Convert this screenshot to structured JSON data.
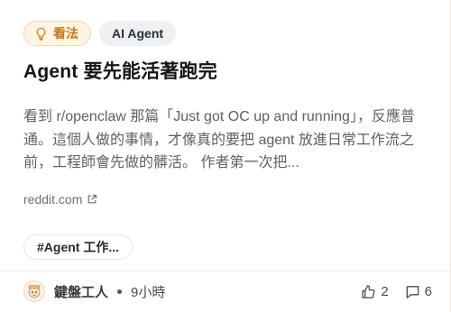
{
  "card": {
    "category_chip": "看法",
    "tag_chip": "AI Agent",
    "title": "Agent 要先能活著跑完",
    "excerpt": "看到 r/openclaw 那篇「Just got OC up and running」，反應普通。這個人做的事情，才像真的要把 agent 放進日常工作流之前，工程師會先做的髒活。 作者第一次把...",
    "source": "reddit.com",
    "hashtag": "#Agent 工作...",
    "author": "鍵盤工人",
    "time": "9小時",
    "likes": "2",
    "comments": "6"
  },
  "icons": {
    "category": "lightbulb-icon",
    "source": "external-link-icon",
    "likes": "thumbs-up-icon",
    "comments": "comment-icon",
    "avatar": "author-avatar"
  },
  "colors": {
    "accent": "#c77a10",
    "chip_bg": "#fdf4e3",
    "title": "#161616",
    "body": "#5d6166"
  }
}
